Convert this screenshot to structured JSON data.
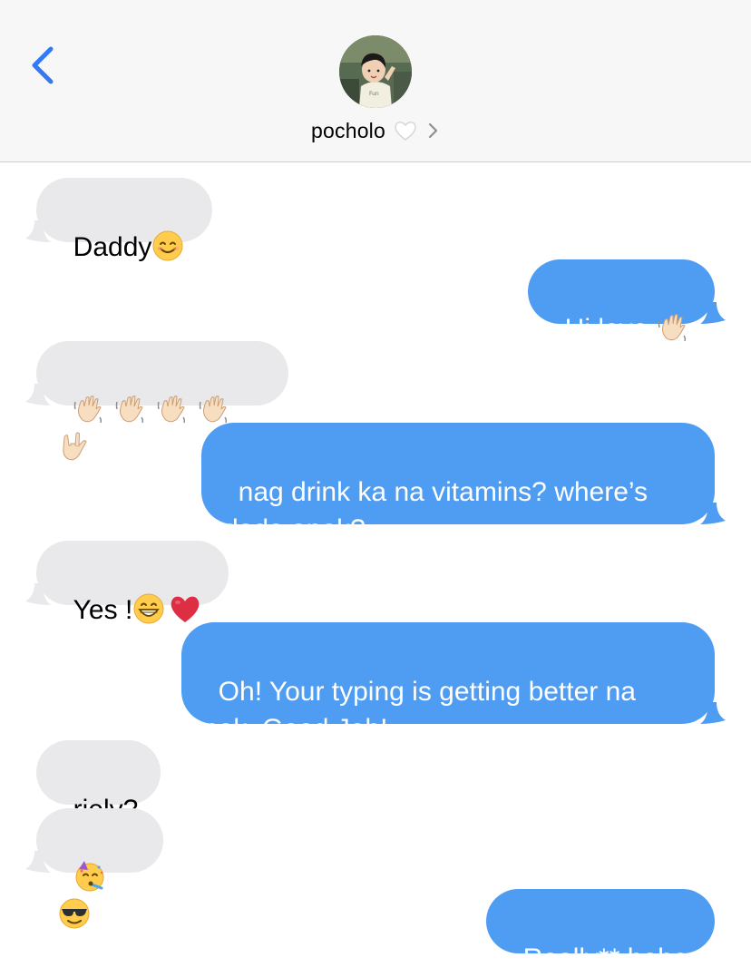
{
  "header": {
    "contact_name": "pocholo",
    "heart_icon": "white-heart-icon",
    "chevron_icon": "chevron-right-icon",
    "back_icon": "chevron-left-icon",
    "accent_color": "#3478f6"
  },
  "messages": [
    {
      "id": 0,
      "direction": "received",
      "text": "Daddy",
      "emojis": [
        "smiling-face"
      ]
    },
    {
      "id": 1,
      "direction": "sent",
      "text": "Hi love ",
      "emojis": [
        "waving-hand"
      ]
    },
    {
      "id": 2,
      "direction": "received",
      "text": "",
      "emojis": [
        "waving-hand",
        "waving-hand",
        "waving-hand",
        "waving-hand",
        "love-you-gesture"
      ]
    },
    {
      "id": 3,
      "direction": "sent",
      "text": "nag drink ka na vitamins? where’s dada anak?",
      "emojis": []
    },
    {
      "id": 4,
      "direction": "received",
      "text": "Yes !",
      "emojis": [
        "grinning-face",
        "red-heart"
      ]
    },
    {
      "id": 5,
      "direction": "sent",
      "text": "Oh! Your typing is getting better na nak, Good Job!",
      "emojis": []
    },
    {
      "id": 6,
      "direction": "received",
      "text": "riely?",
      "emojis": []
    },
    {
      "id": 7,
      "direction": "received",
      "text": "",
      "emojis": [
        "partying-face",
        "sunglasses-face"
      ]
    },
    {
      "id": 8,
      "direction": "sent",
      "text": "Really** hehe",
      "emojis": []
    }
  ],
  "colors": {
    "sent_bubble": "#4f9cf3",
    "received_bubble": "#e9e9eb",
    "header_bg": "#f7f7f7"
  }
}
